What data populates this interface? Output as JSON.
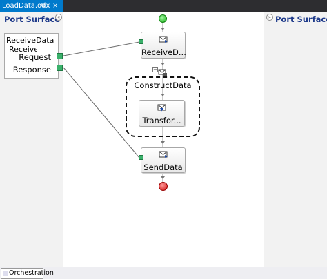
{
  "document_tab": {
    "title": "LoadData.odx",
    "pin_glyph": "⊕",
    "close_glyph": "×"
  },
  "left_panel": {
    "title": "Port Surface",
    "collapse_glyph": "«",
    "port": {
      "name": "ReceiveData",
      "type_partial": "Receive",
      "operations": [
        "Request",
        "Response"
      ]
    }
  },
  "right_panel": {
    "title": "Port Surface",
    "collapse_glyph": "»"
  },
  "orchestration": {
    "receive_shape_label": "ReceiveD...",
    "construct_label": "ConstructData",
    "construct_expander_glyph": "−",
    "transform_shape_label": "Transfor...",
    "send_shape_label": "SendData"
  },
  "bottom_tab": {
    "label": "Orchestration"
  },
  "colors": {
    "accent_tab": "#007acc",
    "panel_title": "#1e3a8a",
    "port_connector": "#3ab16b",
    "start_shape": "#19b319",
    "end_shape": "#d01010"
  }
}
